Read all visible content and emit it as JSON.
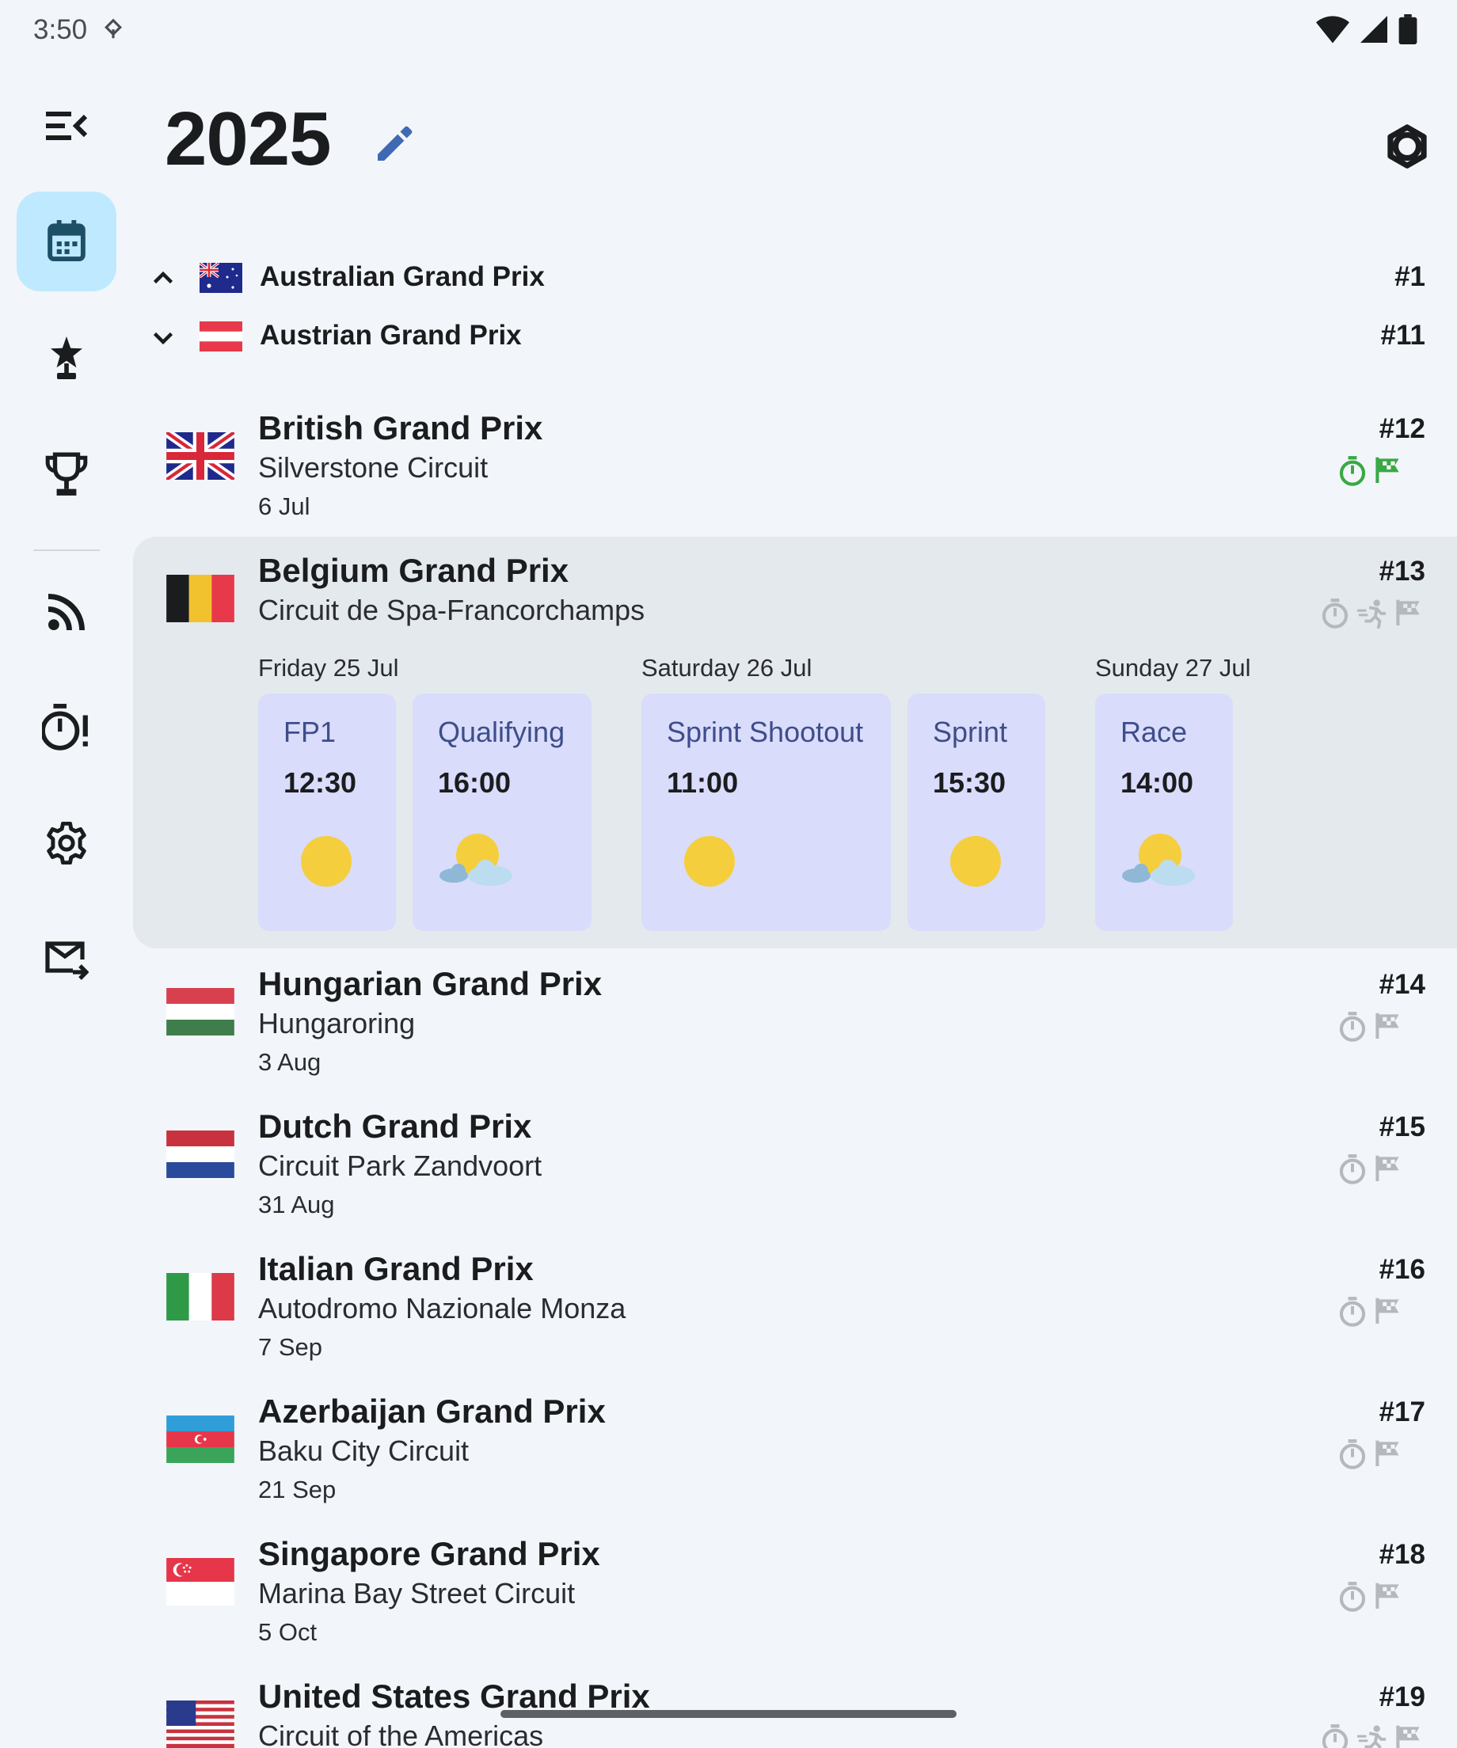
{
  "status": {
    "time": "3:50"
  },
  "header": {
    "title": "2025"
  },
  "collapsed_races": [
    {
      "name": "Australian Grand Prix",
      "round": "#1"
    },
    {
      "name": "Austrian Grand Prix",
      "round": "#11"
    }
  ],
  "races": [
    {
      "name": "British Grand Prix",
      "circuit": "Silverstone Circuit",
      "date": "6 Jul",
      "round": "#12"
    },
    {
      "name": "Belgium Grand Prix",
      "circuit": "Circuit de Spa-Francorchamps",
      "round": "#13"
    },
    {
      "name": "Hungarian Grand Prix",
      "circuit": "Hungaroring",
      "date": "3 Aug",
      "round": "#14"
    },
    {
      "name": "Dutch Grand Prix",
      "circuit": "Circuit Park Zandvoort",
      "date": "31 Aug",
      "round": "#15"
    },
    {
      "name": "Italian Grand Prix",
      "circuit": "Autodromo Nazionale Monza",
      "date": "7 Sep",
      "round": "#16"
    },
    {
      "name": "Azerbaijan Grand Prix",
      "circuit": "Baku City Circuit",
      "date": "21 Sep",
      "round": "#17"
    },
    {
      "name": "Singapore Grand Prix",
      "circuit": "Marina Bay Street Circuit",
      "date": "5 Oct",
      "round": "#18"
    },
    {
      "name": "United States Grand Prix",
      "circuit": "Circuit of the Americas",
      "round": "#19"
    }
  ],
  "belgium_weekend": {
    "days": [
      "Friday 25 Jul",
      "Saturday 26 Jul",
      "Sunday 27 Jul"
    ],
    "sessions": [
      {
        "name": "FP1",
        "time": "12:30",
        "weather": "sunny-icon"
      },
      {
        "name": "Qualifying",
        "time": "16:00",
        "weather": "partly-cloudy-icon"
      },
      {
        "name": "Sprint Shootout",
        "time": "11:00",
        "weather": "sunny-icon"
      },
      {
        "name": "Sprint",
        "time": "15:30",
        "weather": "sunny-icon"
      },
      {
        "name": "Race",
        "time": "14:00",
        "weather": "partly-cloudy-icon"
      }
    ]
  },
  "colors": {
    "background": "#f2f6fa",
    "rail_active": "#bfe9ff",
    "expanded_card": "#e4e9ee",
    "session_card": "#dadcfb",
    "session_name": "#3d4e8a",
    "accent_green": "#3aa845",
    "icon_gray": "#b5b9be",
    "edit_icon": "#3f6ab3"
  }
}
